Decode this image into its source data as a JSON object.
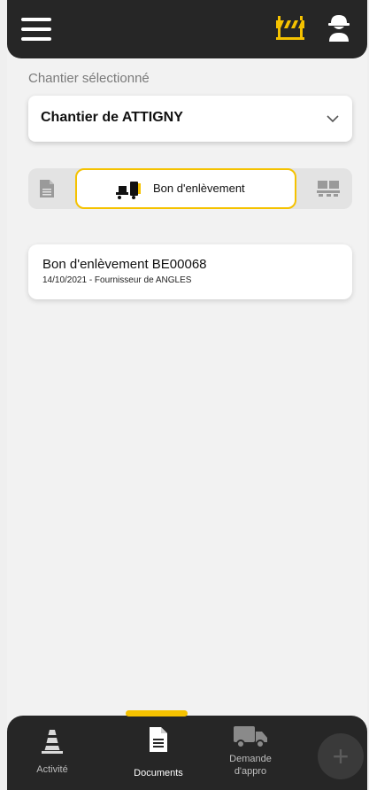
{
  "header": {
    "menu_icon": "hamburger-menu-icon",
    "chantier_icon": "road-barrier-icon",
    "user_icon": "worker-helmet-icon",
    "accent_color": "#f5c200"
  },
  "site_selector": {
    "label": "Chantier sélectionné",
    "value": "Chantier de ATTIGNY"
  },
  "tabs": {
    "left_icon": "document-icon",
    "active_label": "Bon d'enlèvement",
    "active_icon": "pallet-truck-icon",
    "right_icon": "pallet-icon"
  },
  "documents": [
    {
      "title": "Bon d'enlèvement BE00068",
      "subtitle": "14/10/2021 - Fournisseur de ANGLES"
    }
  ],
  "bottom_nav": {
    "items": [
      {
        "label": "Activité",
        "icon": "traffic-cone-icon"
      },
      {
        "label": "Documents",
        "icon": "document-icon"
      },
      {
        "label": "Demande\nd'appro",
        "icon": "truck-icon"
      }
    ],
    "fab_label": "+"
  }
}
